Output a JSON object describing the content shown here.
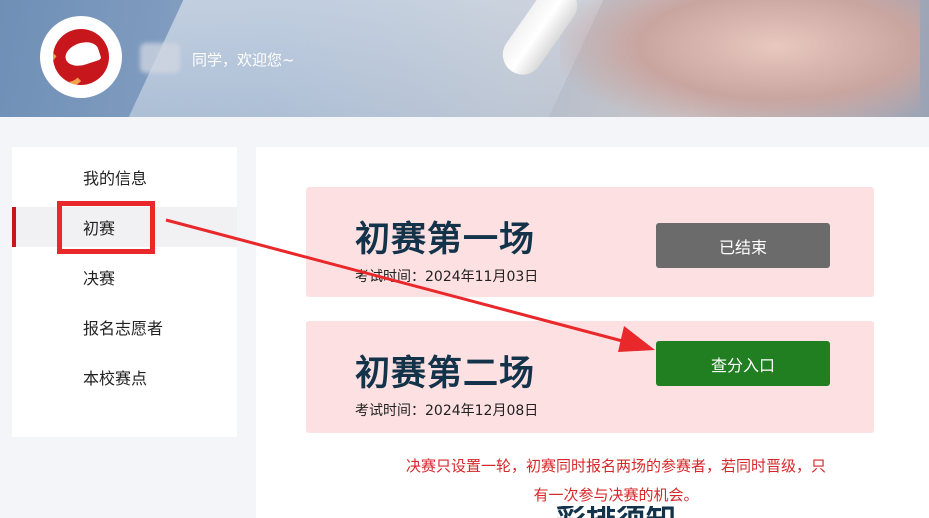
{
  "header": {
    "welcome_text": "同学，欢迎您~",
    "logo_icon": "school-bird-logo"
  },
  "sidebar": {
    "items": [
      {
        "label": "我的信息",
        "active": false
      },
      {
        "label": "初赛",
        "active": true
      },
      {
        "label": "决赛",
        "active": false
      },
      {
        "label": "报名志愿者",
        "active": false
      },
      {
        "label": "本校赛点",
        "active": false
      }
    ]
  },
  "main": {
    "cards": [
      {
        "title": "初赛第一场",
        "time": "考试时间：2024年11月03日",
        "button": "已结束",
        "button_color": "#6b6b6b"
      },
      {
        "title": "初赛第二场",
        "time": "考试时间：2024年12月08日",
        "button": "查分入口",
        "button_color": "#217f22"
      }
    ],
    "notice_line1": "决赛只设置一轮，初赛同时报名两场的参赛者，若同时晋级，只",
    "notice_line2": "有一次参与决赛的机会。",
    "cut_heading": "彩排须知"
  },
  "annotation": {
    "box_color": "#e8282b",
    "arrow_color": "#e8282b"
  }
}
